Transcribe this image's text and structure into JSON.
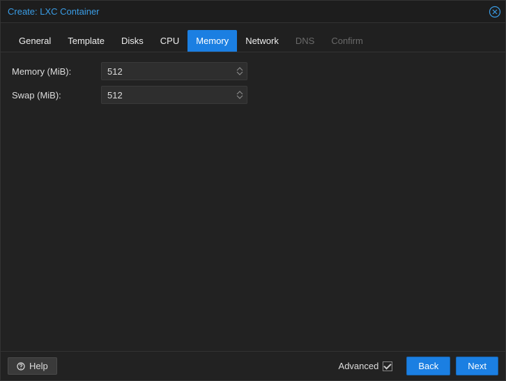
{
  "title": "Create: LXC Container",
  "tabs": {
    "general": "General",
    "template": "Template",
    "disks": "Disks",
    "cpu": "CPU",
    "memory": "Memory",
    "network": "Network",
    "dns": "DNS",
    "confirm": "Confirm"
  },
  "form": {
    "memory_label": "Memory (MiB):",
    "memory_value": "512",
    "swap_label": "Swap (MiB):",
    "swap_value": "512"
  },
  "footer": {
    "help": "Help",
    "advanced": "Advanced",
    "advanced_checked": true,
    "back": "Back",
    "next": "Next"
  }
}
